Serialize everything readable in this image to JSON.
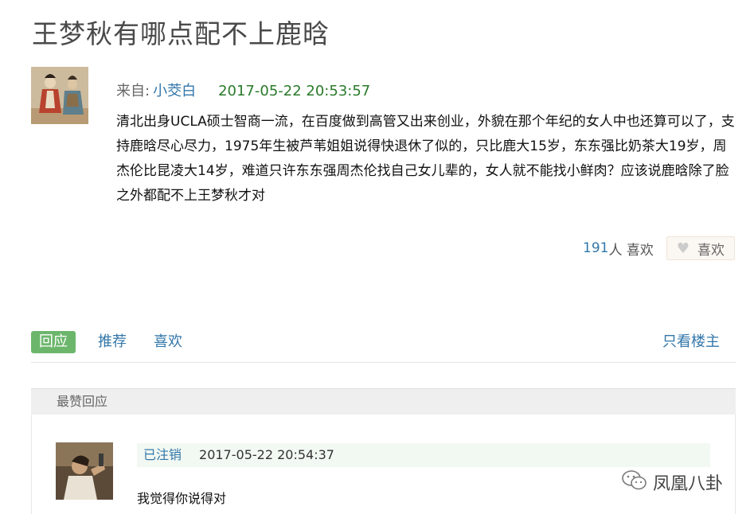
{
  "post": {
    "title": "王梦秋有哪点配不上鹿晗",
    "from_label": "来自:",
    "author": "小茭白",
    "timestamp": "2017-05-22 20:53:57",
    "content": "清北出身UCLA硕士智商一流，在百度做到高管又出来创业，外貌在那个年纪的女人中也还算可以了，支持鹿晗尽心尽力，1975年生被芦苇姐姐说得快退休了似的，只比鹿大15岁，东东强比奶茶大19岁，周杰伦比昆凌大14岁，难道只许东东强周杰伦找自己女儿辈的，女人就不能找小鲜肉？应该说鹿晗除了脸之外都配不上王梦秋才对",
    "likes_count": "191",
    "likes_suffix": "人 喜欢",
    "like_button_label": "喜欢"
  },
  "tabs": {
    "reply": "回应",
    "recommend": "推荐",
    "like": "喜欢",
    "only_op": "只看楼主"
  },
  "best_replies": {
    "header": "最赞回应",
    "items": [
      {
        "author": "已注销",
        "timestamp": "2017-05-22 20:54:37",
        "text": "我觉得你说得对"
      }
    ]
  },
  "watermark": {
    "text": "凤凰八卦",
    "icon": "wechat-icon"
  },
  "colors": {
    "link": "#3377aa",
    "timestamp_green": "#2a7a2a",
    "active_tab": "#6cb66c"
  }
}
